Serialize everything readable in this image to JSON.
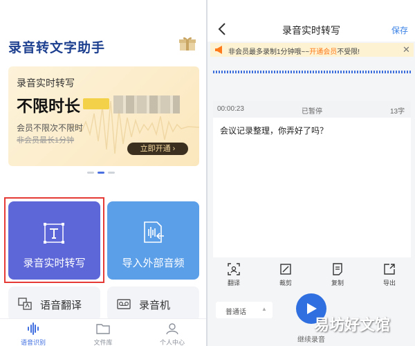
{
  "left": {
    "app_title": "录音转文字助手",
    "banner": {
      "subtitle": "录音实时转写",
      "headline": "不限时长",
      "description": "会员不限次不限时",
      "strikethrough": "非会员最长1分钟",
      "cta": "立即开通 ›"
    },
    "tiles": {
      "realtime": "录音实时转写",
      "import": "导入外部音频",
      "translate": "语音翻译",
      "recorder": "录音机"
    },
    "tabs": {
      "recognition": "语音识别",
      "library": "文件库",
      "profile": "个人中心"
    }
  },
  "right": {
    "title": "录音实时转写",
    "save": "保存",
    "notice": {
      "prefix": "非会员最多录制1分钟哦~~",
      "link": "开通会员",
      "suffix": "不受限!",
      "close": "✕"
    },
    "transcript": {
      "timer": "00:00:23",
      "status": "已暂停",
      "count": "13字",
      "text": "会议记录整理，你弄好了吗？"
    },
    "tools": {
      "translate": "翻译",
      "crop": "裁剪",
      "copy": "复制",
      "export": "导出"
    },
    "language": "普通话",
    "language_caret": "▲",
    "continue": "继续录音"
  },
  "watermark": "易坊好文馆",
  "colors": {
    "brand_blue": "#1d3f8f",
    "tile_purple": "#5e67d8",
    "tile_blue": "#5b9fe9",
    "accent_blue": "#3b82e6",
    "highlight_red": "#e53935",
    "notice_orange": "#ff7a1a",
    "banner_gold": "#fbe7bd"
  },
  "icons": [
    "gift-icon",
    "text-t-icon",
    "audio-file-icon",
    "translate-icon",
    "recorder-icon",
    "waveform-icon",
    "folder-icon",
    "user-icon",
    "back-arrow-icon",
    "megaphone-icon",
    "close-icon",
    "translate-tool-icon",
    "crop-icon",
    "copy-icon",
    "export-icon",
    "play-icon"
  ]
}
